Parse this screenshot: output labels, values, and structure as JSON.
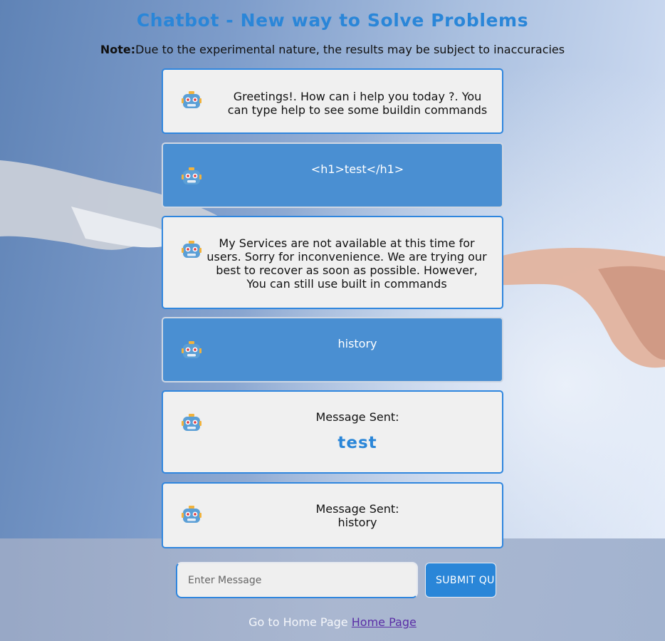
{
  "header": {
    "title": "Chatbot - New way to Solve Problems",
    "note_label": "Note:",
    "note_text": "Due to the experimental nature, the results may be subject to inaccuracies"
  },
  "messages": [
    {
      "style": "light",
      "text": "Greetings!. How can i help you today ?. You can type help to see some buildin commands"
    },
    {
      "style": "blue",
      "text": "<h1>test</h1>"
    },
    {
      "style": "light",
      "text": "My Services are not available at this time for users. Sorry for inconvenience. We are trying our best to recover as soon as possible. However, You can still use built in commands"
    },
    {
      "style": "blue",
      "text": "history"
    },
    {
      "style": "light",
      "label": "Message Sent:",
      "value": "test"
    },
    {
      "style": "light",
      "label": "Message Sent:",
      "value": "history"
    }
  ],
  "composer": {
    "placeholder": "Enter Message",
    "submit_label": "SUBMIT QUERY"
  },
  "footer": {
    "text": "Go to Home Page",
    "link_label": "Home Page"
  },
  "colors": {
    "accent": "#2a86d8",
    "bot_bubble": "#4a8fd2",
    "light_bubble": "#f0f0f0",
    "link": "#5a2ea6"
  },
  "icons": {
    "avatar": "robot-icon"
  }
}
